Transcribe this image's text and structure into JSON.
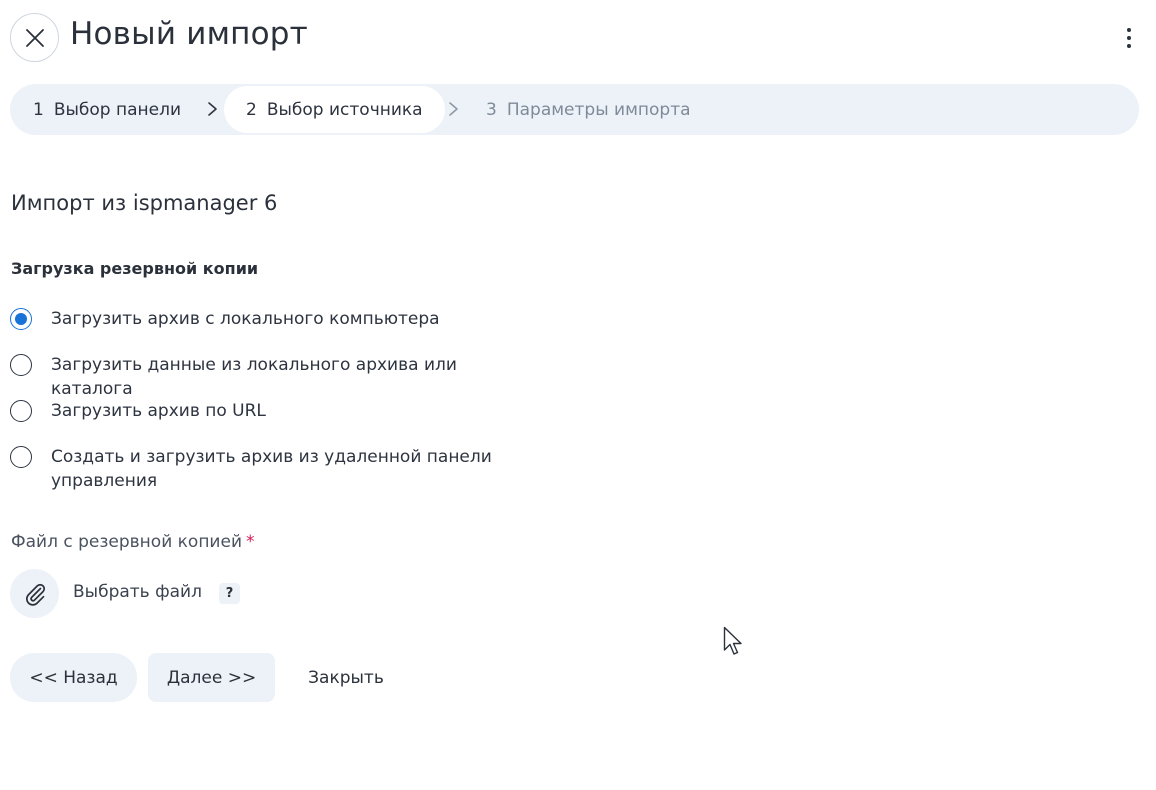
{
  "header": {
    "title": "Новый импорт"
  },
  "stepper": {
    "steps": [
      {
        "num": "1",
        "label": "Выбор панели",
        "state": "done"
      },
      {
        "num": "2",
        "label": "Выбор источника",
        "state": "active"
      },
      {
        "num": "3",
        "label": "Параметры импорта",
        "state": "upcoming"
      }
    ]
  },
  "form": {
    "section_title": "Импорт из ispmanager 6",
    "group_label": "Загрузка резервной копии",
    "options": [
      {
        "label": "Загрузить архив с локального компьютера",
        "checked": true
      },
      {
        "label": "Загрузить данные из локального архива или каталога",
        "checked": false
      },
      {
        "label": "Загрузить архив по URL",
        "checked": false
      },
      {
        "label": "Создать и загрузить архив из удаленной панели управления",
        "checked": false
      }
    ],
    "file_label": "Файл с резервной копией",
    "required_mark": "*",
    "choose_file_label": "Выбрать файл",
    "help_label": "?"
  },
  "footer": {
    "back_label": "<< Назад",
    "next_label": "Далее >>",
    "close_label": "Закрыть"
  },
  "colors": {
    "accent": "#1a73d6",
    "panel_bg": "#edf2f8",
    "required": "#d11a54",
    "muted_text": "#7f8a99"
  }
}
